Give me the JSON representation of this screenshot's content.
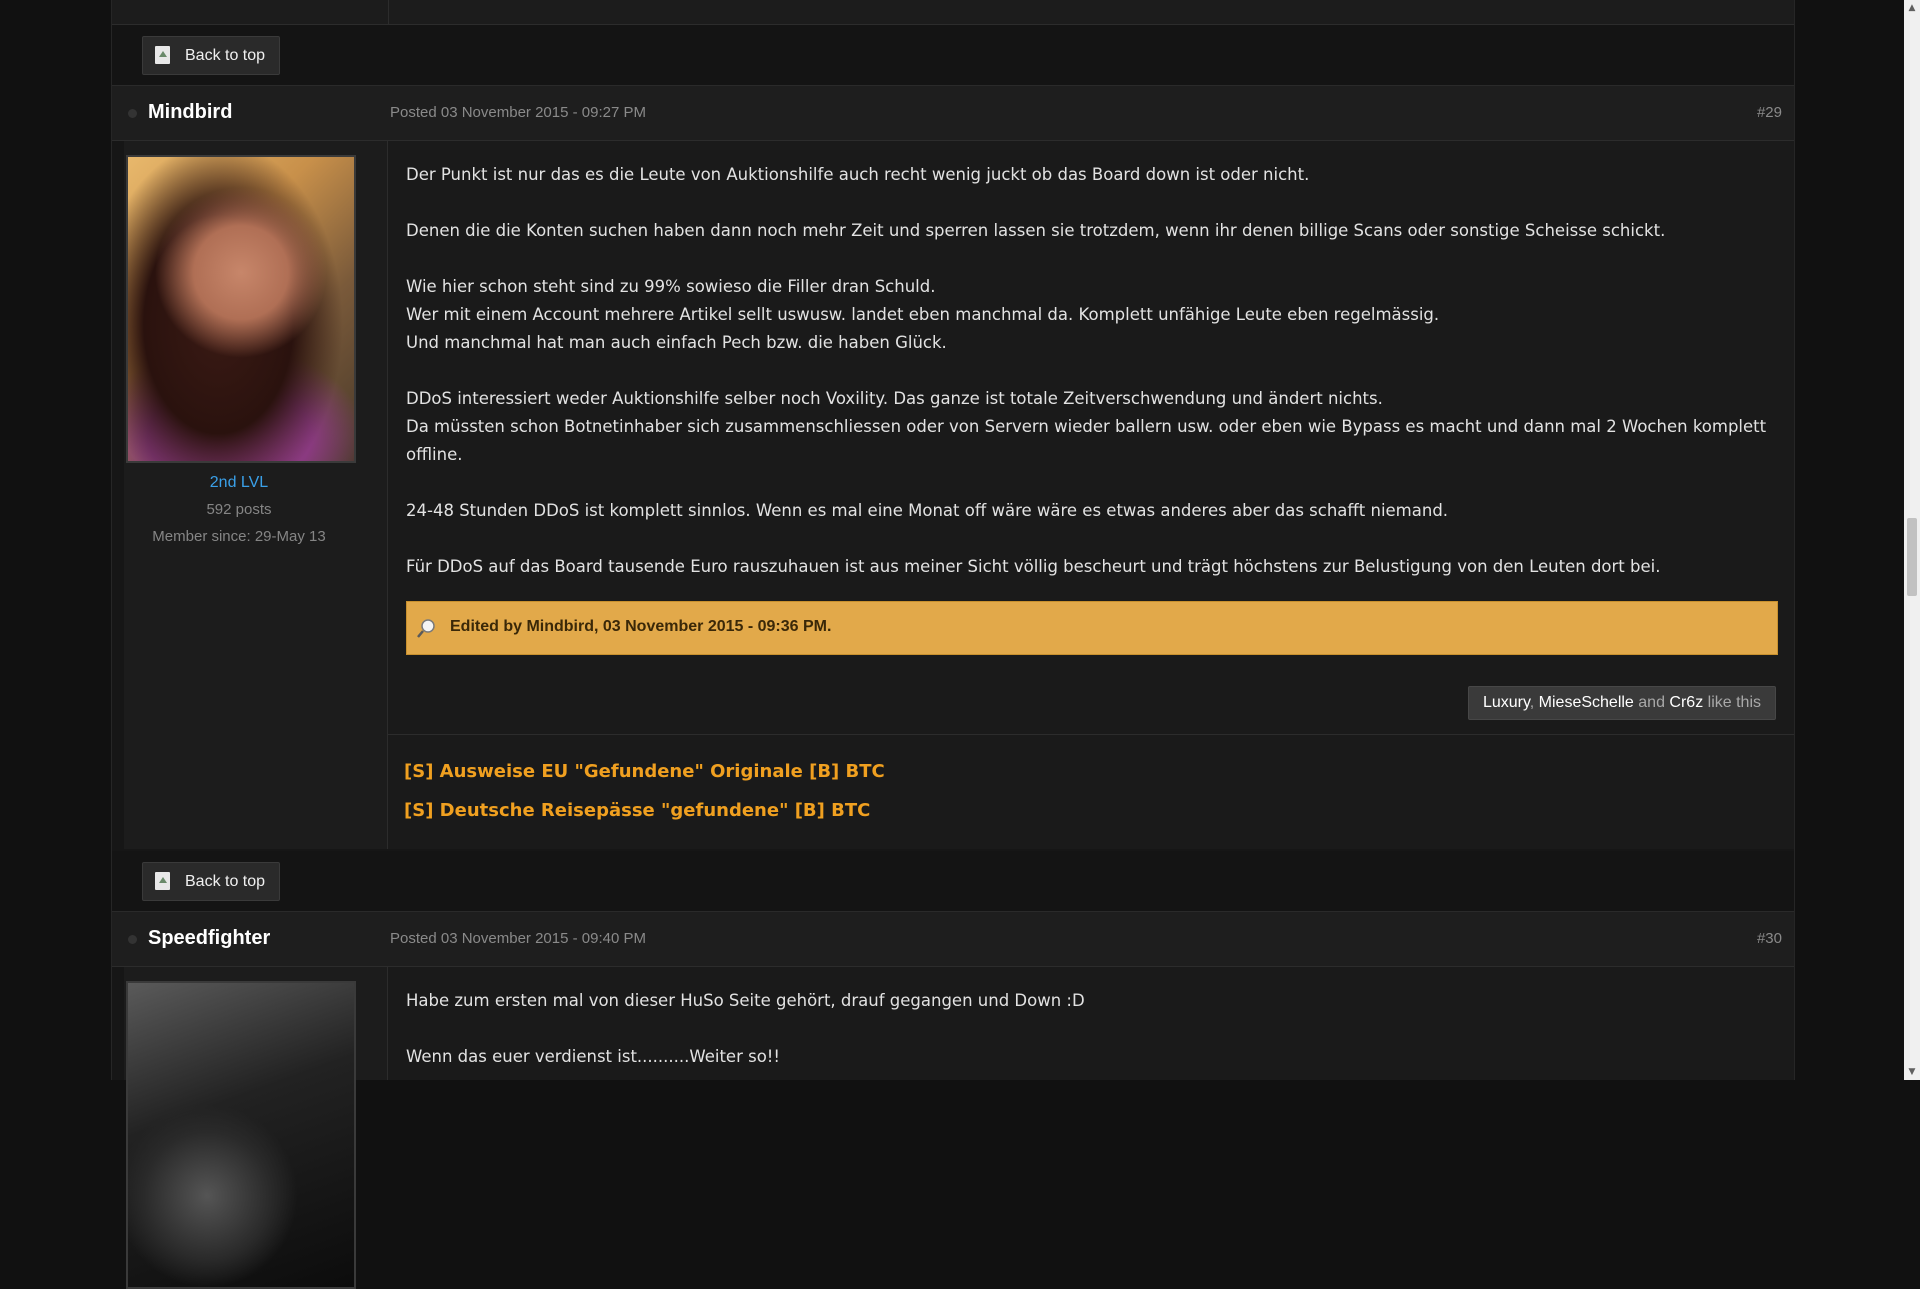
{
  "back_to_top_label": "Back to top",
  "posts": [
    {
      "username": "Mindbird",
      "posted": "Posted 03 November 2015 - 09:27 PM",
      "number": "#29",
      "rank": "2nd LVL",
      "post_count": "592 posts",
      "member_since": "Member since: 29-May 13",
      "paragraphs": [
        "Der Punkt ist nur das es die Leute von Auktionshilfe auch recht wenig juckt ob das Board down ist oder nicht.",
        "Denen die die Konten suchen haben dann noch mehr Zeit und sperren lassen sie trotzdem, wenn ihr denen billige Scans oder sonstige Scheisse schickt.",
        "Wie hier schon steht sind zu 99% sowieso die Filler dran Schuld.\nWer mit einem Account mehrere Artikel sellt uswusw. landet eben manchmal da. Komplett unfähige Leute eben regelmässig.\nUnd manchmal hat man auch einfach Pech bzw. die haben Glück.",
        "DDoS interessiert weder Auktionshilfe selber noch Voxility. Das ganze ist totale Zeitverschwendung und ändert nichts.\nDa müssten schon Botnetinhaber sich zusammenschliessen oder von Servern wieder ballern usw. oder eben wie Bypass es macht und dann mal 2 Wochen komplett offline.",
        "24-48 Stunden DDoS ist komplett sinnlos. Wenn es mal eine Monat off wäre wäre es etwas anderes aber das schafft niemand.",
        "Für DDoS auf das Board tausende Euro rauszuhauen ist aus meiner Sicht völlig bescheurt und trägt höchstens zur Belustigung von den Leuten dort bei."
      ],
      "edit_note": "Edited by Mindbird, 03 November 2015 - 09:36 PM.",
      "likes": {
        "users": [
          "Luxury",
          "MieseSchelle",
          "Cr6z"
        ],
        "sep1": ", ",
        "and": " and ",
        "suffix": " like this"
      },
      "signature_links": [
        "[S] Ausweise EU \"Gefundene\" Originale [B] BTC",
        "[S] Deutsche Reisepässe \"gefundene\" [B] BTC"
      ]
    },
    {
      "username": "Speedfighter",
      "posted": "Posted 03 November 2015 - 09:40 PM",
      "number": "#30",
      "paragraphs": [
        "Habe zum ersten mal von dieser HuSo Seite gehört, drauf gegangen und Down :D",
        "Wenn das euer verdienst ist..........Weiter so!!"
      ]
    }
  ],
  "colors": {
    "accent_link": "#f0a020",
    "rank_blue": "#3aa0e8",
    "edit_bar": "#e2a94a"
  },
  "icons": {
    "back_to_top": "page-up-icon",
    "edit": "magnifier-edit-icon",
    "status": "offline-dot-icon"
  }
}
